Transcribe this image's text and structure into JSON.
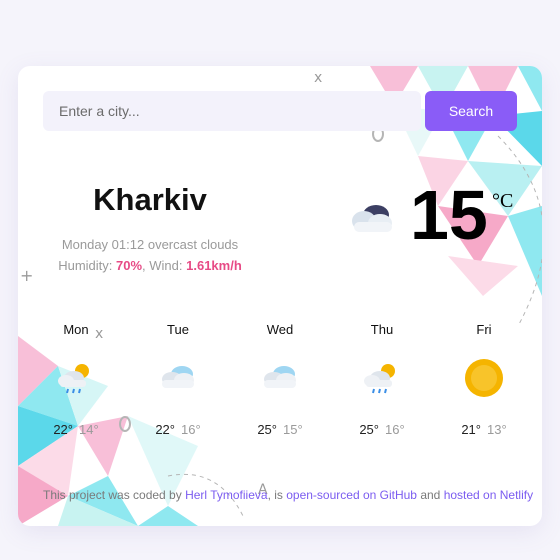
{
  "search": {
    "placeholder": "Enter a city...",
    "button_label": "Search"
  },
  "current": {
    "city": "Kharkiv",
    "datetime": "Monday 01:12",
    "description": "overcast clouds",
    "humidity_label": "Humidity: ",
    "humidity": "70%",
    "wind_label": ", Wind: ",
    "wind": "1.61km/h",
    "temperature": "15",
    "unit": "°C",
    "icon": "cloud-icon"
  },
  "forecast": [
    {
      "day": "Mon",
      "max": "22°",
      "min": "14°",
      "icon": "sun-cloud-rain-icon"
    },
    {
      "day": "Tue",
      "max": "22°",
      "min": "16°",
      "icon": "cloud-icon"
    },
    {
      "day": "Wed",
      "max": "25°",
      "min": "15°",
      "icon": "cloud-icon"
    },
    {
      "day": "Thu",
      "max": "25°",
      "min": "16°",
      "icon": "sun-cloud-rain-icon"
    },
    {
      "day": "Fri",
      "max": "21°",
      "min": "13°",
      "icon": "sun-icon"
    }
  ],
  "footer": {
    "text1": "This project was coded by ",
    "author": "Herl Tymofiieva",
    "text2": ", is ",
    "github": "open-sourced on GitHub",
    "text3": " and ",
    "netlify": "hosted on Netlify"
  },
  "colors": {
    "accent": "#8a5cf7",
    "highlight": "#e74b86",
    "background": "#f5f4fb"
  }
}
